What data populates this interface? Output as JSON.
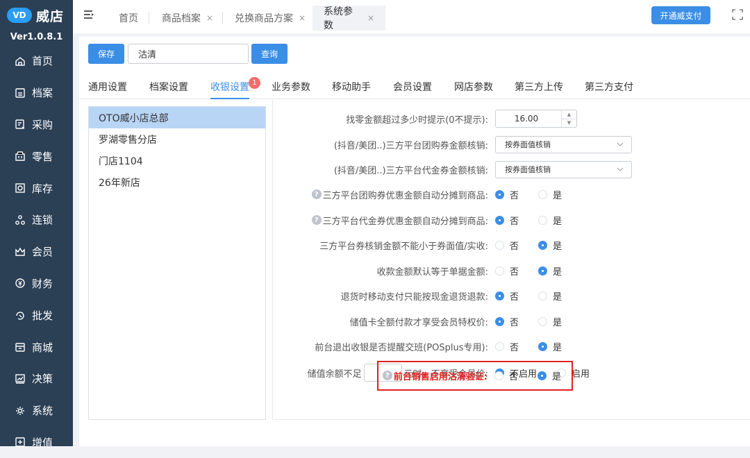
{
  "app": {
    "logo_mark": "VD",
    "name": "威店",
    "version": "Ver1.0.8.1"
  },
  "sidebar": {
    "items": [
      {
        "label": "首页",
        "icon": "home-icon"
      },
      {
        "label": "档案",
        "icon": "archive-icon"
      },
      {
        "label": "采购",
        "icon": "purchase-icon"
      },
      {
        "label": "零售",
        "icon": "retail-icon"
      },
      {
        "label": "库存",
        "icon": "inventory-icon"
      },
      {
        "label": "连锁",
        "icon": "chain-icon"
      },
      {
        "label": "会员",
        "icon": "member-icon"
      },
      {
        "label": "财务",
        "icon": "finance-icon"
      },
      {
        "label": "批发",
        "icon": "wholesale-icon"
      },
      {
        "label": "商城",
        "icon": "mall-icon"
      },
      {
        "label": "决策",
        "icon": "decision-icon"
      },
      {
        "label": "系统",
        "icon": "system-icon"
      },
      {
        "label": "增值",
        "icon": "value-added-icon"
      }
    ]
  },
  "topbar": {
    "tabs": [
      {
        "label": "首页",
        "closable": false
      },
      {
        "label": "商品档案",
        "closable": true
      },
      {
        "label": "兑换商品方案",
        "closable": true
      },
      {
        "label": "系统参数",
        "closable": true,
        "active": true
      }
    ],
    "close_glyph": "×",
    "open_pay_label": "开通威支付"
  },
  "toolbar": {
    "save_label": "保存",
    "search_value": "沽清",
    "query_label": "查询"
  },
  "settings_tabs": {
    "items": [
      "通用设置",
      "档案设置",
      "收银设置",
      "业务参数",
      "移动助手",
      "会员设置",
      "网店参数",
      "第三方上传",
      "第三方支付"
    ],
    "active_index": 2,
    "badge_count": "1"
  },
  "stores": [
    "OTO威小店总部",
    "罗湖零售分店",
    "门店1104",
    "26年新店"
  ],
  "selected_store_index": 0,
  "form": {
    "change_prompt": {
      "label": "找零金额超过多少时提示(0不提示):",
      "value": "16.00"
    },
    "group_coupon": {
      "label": "(抖音/美团..)三方平台团购券金额核销:",
      "value": "按券面值核销"
    },
    "voucher_coupon": {
      "label": "(抖音/美团..)三方平台代金券金额核销:",
      "value": "按券面值核销"
    },
    "group_coupon_split": {
      "label": "三方平台团购券优惠金额自动分摊到商品:",
      "no": "否",
      "yes": "是",
      "selected": "no"
    },
    "voucher_coupon_split": {
      "label": "三方平台代金券优惠金额自动分摊到商品:",
      "no": "否",
      "yes": "是",
      "selected": "no"
    },
    "verify_not_below": {
      "label": "三方平台券核销金额不能小于券面值/实收:",
      "no": "否",
      "yes": "是",
      "selected": "yes"
    },
    "collect_default": {
      "label": "收款金额默认等于单据金额:",
      "no": "否",
      "yes": "是",
      "selected": "yes"
    },
    "refund_cash_only": {
      "label": "退货时移动支付只能按现金退货退款:",
      "no": "否",
      "yes": "是",
      "selected": "no"
    },
    "stored_card_privilege": {
      "label": "储值卡全额付款才享受会员特权价:",
      "no": "否",
      "yes": "是",
      "selected": "no"
    },
    "exit_remind_shift": {
      "label": "前台退出收银是否提醒交班(POSplus专用):",
      "no": "否",
      "yes": "是",
      "selected": "yes"
    },
    "stored_balance": {
      "prefix": "储值余额不足",
      "suffix": "元时，不享受会员价:",
      "disable": "不启用",
      "enable": "启用",
      "selected": "disable"
    },
    "clearance_verify": {
      "label": "前台销售启用沽清验证:",
      "no": "否",
      "yes": "是",
      "selected": "yes"
    }
  },
  "colors": {
    "accent": "#3a8ee6",
    "sidebar_bg": "#2b3f55",
    "highlight": "#e02020",
    "selected_row": "#b8d5f5"
  }
}
